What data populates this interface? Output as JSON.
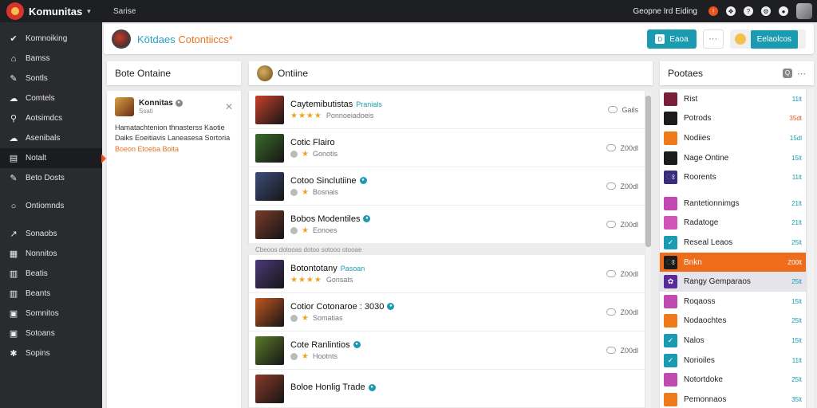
{
  "topbar": {
    "brand": "Komunitas",
    "caret": "▾",
    "search": "Sarise",
    "user": "Geopne Ird Eiding",
    "alert_glyph": "!",
    "icons": [
      "alert-icon",
      "gift-icon",
      "help-icon",
      "settings-icon",
      "chat-icon"
    ]
  },
  "sidebar": {
    "items": [
      {
        "icon": "✔",
        "label": "Komnoiking"
      },
      {
        "icon": "⌂",
        "label": "Bamss"
      },
      {
        "icon": "✎",
        "label": "Sontls"
      },
      {
        "icon": "☁",
        "label": "Comtels"
      },
      {
        "icon": "⚲",
        "label": "Aotsimdcs"
      },
      {
        "icon": "☁",
        "label": "Asenibals"
      },
      {
        "icon": "▤",
        "label": "Notalt"
      },
      {
        "icon": "✎",
        "label": "Beto Dosts"
      },
      {
        "icon": "○",
        "label": "Ontiomnds"
      },
      {
        "icon": "↗",
        "label": "Sonaobs"
      },
      {
        "icon": "▦",
        "label": "Nonnitos"
      },
      {
        "icon": "▥",
        "label": "Beatis"
      },
      {
        "icon": "▥",
        "label": "Beants"
      },
      {
        "icon": "▣",
        "label": "Somnitos"
      },
      {
        "icon": "▣",
        "label": "Sotoans"
      },
      {
        "icon": "✱",
        "label": "Sopins"
      }
    ],
    "active_index": 6
  },
  "header": {
    "title_a": "Kötdaes",
    "title_b": "Cotontiiccs",
    "title_mark": "*",
    "btn_primary_icon": "D",
    "btn_primary": "Eaoa",
    "more": "···",
    "btn_secondary": "Eelaolcos"
  },
  "left": {
    "head": "Bote Ontaine",
    "notif": {
      "name": "Konnitas",
      "badge": "●",
      "sub": "Ssati",
      "close": "✕",
      "text": "Hamatachtenion thnasterss Kaotie Daiks Eoeitiavis Laneasesa Sortoria",
      "link": "Boeon Etoeba Boita"
    }
  },
  "middle": {
    "head": "Ontiine",
    "separator": "Cbeoos dotooas dotoo sotooo otooae",
    "groups": [
      [
        {
          "title": "Caytemibutistas",
          "badge": "Pranials",
          "meta": "Ponnoeiadoeis",
          "stars": "★★★★",
          "count": "Gails"
        },
        {
          "title": "Cotic Flairo",
          "badge": "",
          "meta": "Gonotis",
          "stars": "",
          "count": "Z00dl"
        },
        {
          "title": "Cotoo Sinclutiine",
          "badge": "●",
          "meta": "Bosnais",
          "stars": "",
          "count": "Z00dl"
        },
        {
          "title": "Bobos Modentiles",
          "badge": "●",
          "meta": "Eonoes",
          "stars": "",
          "count": "Z00dl"
        }
      ],
      [
        {
          "title": "Botontotany",
          "badge": "Pasoan",
          "meta": "Gonsats",
          "stars": "★★★★",
          "count": "Z00dl"
        },
        {
          "title": "Cotior Cotonaroe : 3030",
          "badge": "●",
          "meta": "Somatias",
          "stars": "",
          "count": "Z00dl"
        },
        {
          "title": "Cote Ranlintios",
          "badge": "●",
          "meta": "Hootnts",
          "stars": "",
          "count": "Z00dl"
        },
        {
          "title": "Boloe Honlig Trade",
          "badge": "●",
          "meta": "",
          "stars": "",
          "count": ""
        }
      ]
    ],
    "thumb_colors": [
      "#c7402a",
      "#3b6b2a",
      "#3c4d7a",
      "#7a3b2a",
      "#4b3a7a",
      "#c0561f",
      "#5a7a2a",
      "#8a3a2a"
    ]
  },
  "right": {
    "head": "Pootaes",
    "head_icon": "Q",
    "head_dots": "⋯",
    "items": [
      {
        "name": "Rist",
        "count": "11lt",
        "color": "#7a1f3a",
        "glyph": "",
        "warn": false
      },
      {
        "name": "Potrods",
        "count": "35dt",
        "color": "#1b1b1b",
        "glyph": "",
        "warn": true
      },
      {
        "name": "Nodiies",
        "count": "15dl",
        "color": "#ef7a1a",
        "glyph": "",
        "warn": false
      },
      {
        "name": "Nage Ontine",
        "count": "15lt",
        "color": "#1b1b1b",
        "glyph": "",
        "warn": false
      },
      {
        "name": "Roorents",
        "count": "11lt",
        "color": "#3a2a7a",
        "glyph": "ଃ",
        "warn": false
      },
      {
        "name": "Rantetionnimgs",
        "count": "21lt",
        "color": "#c04ab0",
        "glyph": "",
        "warn": false
      },
      {
        "name": "Radatoge",
        "count": "21lt",
        "color": "#d055b8",
        "glyph": "",
        "warn": false
      },
      {
        "name": "Reseal Leaos",
        "count": "25lt",
        "color": "#1a9bb0",
        "glyph": "✓",
        "warn": false
      },
      {
        "name": "Bnkn",
        "count": "Z00lt",
        "color": "#1b1b1b",
        "glyph": "ଃ",
        "warn": false,
        "selected": true
      },
      {
        "name": "Rangy Gemparaos",
        "count": "25lt",
        "color": "#5a2a9a",
        "glyph": "✿",
        "warn": false,
        "highlight": true
      },
      {
        "name": "Roqaoss",
        "count": "15lt",
        "color": "#c04ab0",
        "glyph": "",
        "warn": false
      },
      {
        "name": "Nodaochtes",
        "count": "25lt",
        "color": "#ef7a1a",
        "glyph": "",
        "warn": false
      },
      {
        "name": "Nalos",
        "count": "15lt",
        "color": "#1a9bb0",
        "glyph": "✓",
        "warn": false
      },
      {
        "name": "Norioiles",
        "count": "11lt",
        "color": "#1a9bb0",
        "glyph": "✓",
        "warn": false
      },
      {
        "name": "Notortdoke",
        "count": "25lt",
        "color": "#c04ab0",
        "glyph": "",
        "warn": false
      },
      {
        "name": "Pemonnaos",
        "count": "35lt",
        "color": "#ef7a1a",
        "glyph": "",
        "warn": false
      }
    ]
  }
}
